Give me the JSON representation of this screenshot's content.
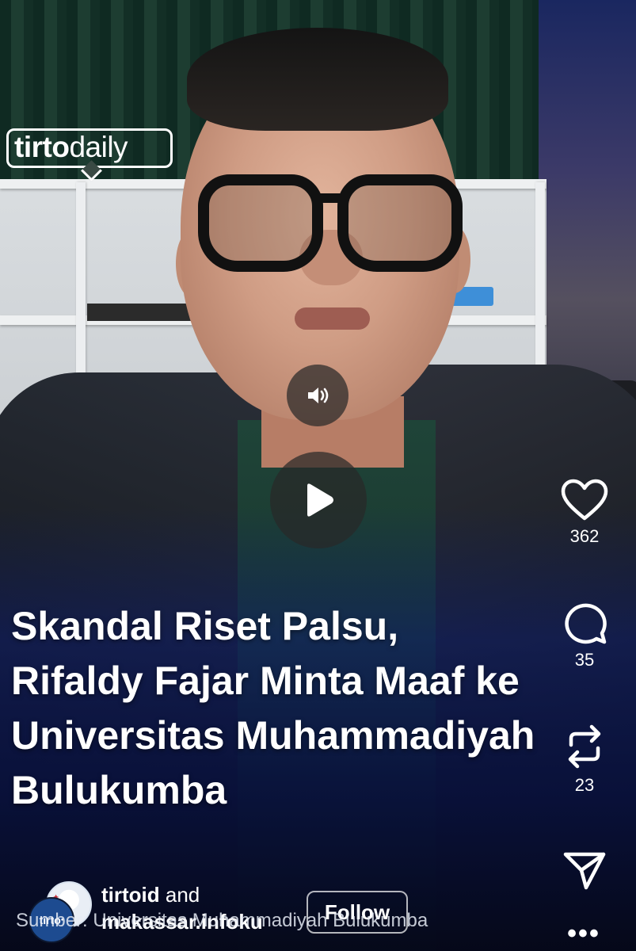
{
  "logo": {
    "text_bold": "tirto",
    "text_light": "daily"
  },
  "headline": {
    "lines": [
      "Skandal Riset Palsu,",
      "Rifaldy Fajar Minta Maaf ke",
      "Universitas Muhammadiyah",
      "Bulukumba"
    ]
  },
  "actions": {
    "likes": "362",
    "comments": "35",
    "reposts": "23"
  },
  "author": {
    "primary": "tirtoid",
    "joiner": " and",
    "secondary": "makassar.infoku",
    "follow_label": "Follow",
    "avatar_b_text": "tirto"
  },
  "source_caption": "Sumber: Universitas Muhammadiyah Bulukumba",
  "more_label": "•••",
  "icons": {
    "sound": "speaker-icon",
    "play": "play-icon",
    "like": "heart-icon",
    "comment": "comment-bubble-icon",
    "repost": "repost-icon",
    "share": "send-icon",
    "more": "more-dots-icon"
  }
}
